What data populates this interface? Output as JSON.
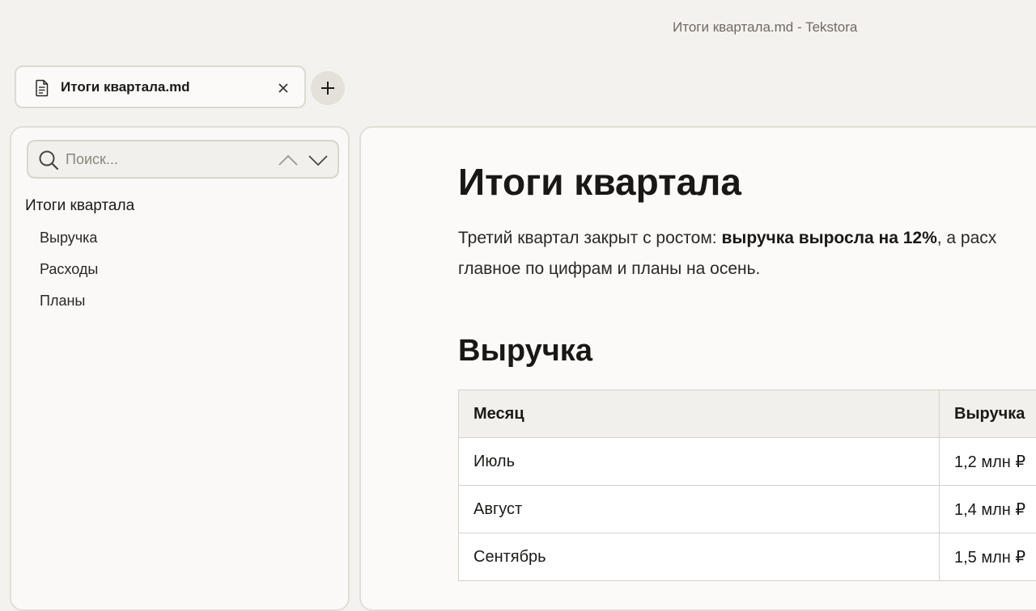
{
  "window": {
    "title": "Итоги квартала.md - Tekstora"
  },
  "tabs": [
    {
      "label": "Итоги квартала.md",
      "icon": "file-text-icon",
      "close_icon": "close-icon"
    }
  ],
  "new_tab": {
    "icon": "plus-icon"
  },
  "sidebar": {
    "search": {
      "placeholder": "Поиск...",
      "value": ""
    },
    "outline": [
      {
        "label": "Итоги квартала",
        "level": 1
      },
      {
        "label": "Выручка",
        "level": 2
      },
      {
        "label": "Расходы",
        "level": 2
      },
      {
        "label": "Планы",
        "level": 2
      }
    ]
  },
  "document": {
    "title": "Итоги квартала",
    "paragraph": {
      "before": "Третий квартал закрыт с ростом: ",
      "bold": "выручка выросла на 12%",
      "after": ", а расх",
      "line2": "главное по цифрам и планы на осень."
    },
    "revenue_heading": "Выручка",
    "table": {
      "headers": [
        "Месяц",
        "Выручка"
      ],
      "rows": [
        [
          "Июль",
          "1,2 млн ₽"
        ],
        [
          "Август",
          "1,4 млн ₽"
        ],
        [
          "Сентябрь",
          "1,5 млн ₽"
        ]
      ]
    }
  },
  "colors": {
    "background": "#f4f2ee",
    "panel": "#fbfaf8",
    "border": "#e2ded7",
    "text": "#1c1a17"
  }
}
